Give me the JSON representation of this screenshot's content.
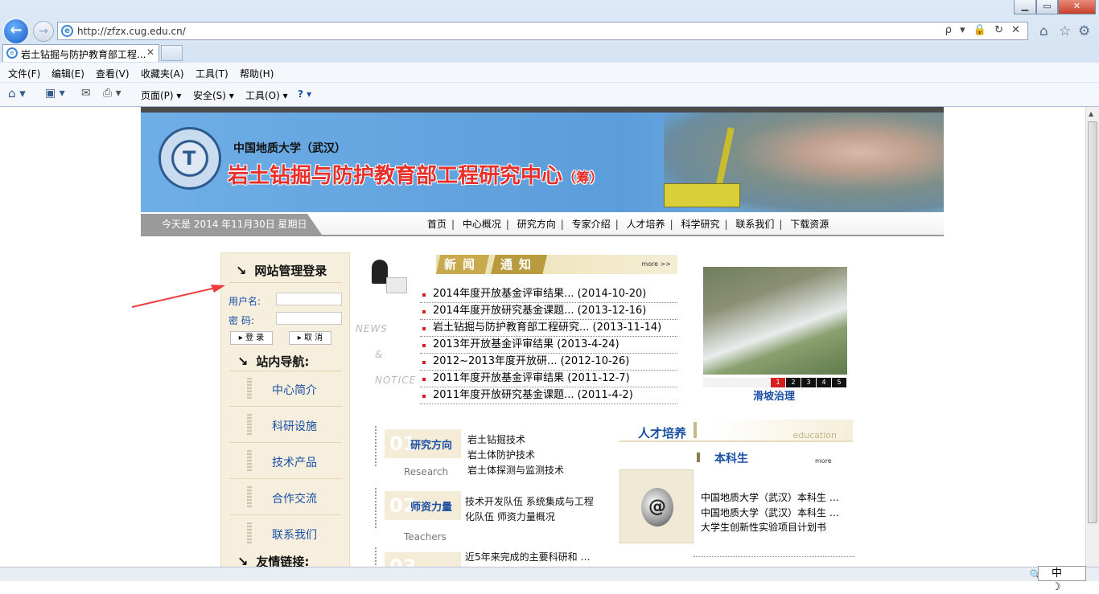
{
  "browser": {
    "url": "http://zfzx.cug.edu.cn/",
    "tab_title": "岩土钻掘与防护教育部工程...",
    "window_controls": [
      "▁",
      "▭",
      "✕"
    ],
    "address_tools": "ρ ▾ 🔒 ↻ ✕",
    "menu": [
      "文件(F)",
      "编辑(E)",
      "查看(V)",
      "收藏夹(A)",
      "工具(T)",
      "帮助(H)"
    ],
    "commands": {
      "page": "页面(P) ▾",
      "safety": "安全(S) ▾",
      "tools": "工具(O) ▾",
      "help": "? ▾"
    },
    "ime": "中 ☽",
    "zoom": "🔍 1"
  },
  "banner": {
    "university": "中国地质大学（武汉）",
    "center_name": "岩土钻掘与防护教育部工程研究中心",
    "center_suffix": "（筹）"
  },
  "nav": {
    "date_text": "今天是  2014 年11月30日  星期日",
    "links": [
      "首页",
      "中心概况",
      "研究方向",
      "专家介绍",
      "人才培养",
      "科学研究",
      "联系我们",
      "下载资源"
    ]
  },
  "sidebar": {
    "login_title": "网站管理登录",
    "username_label": "用户名:",
    "password_label": "密  码:",
    "login_button": "▸ 登 录",
    "cancel_button": "▸ 取 消",
    "site_nav_title": "站内导航:",
    "items": [
      "中心简介",
      "科研设施",
      "技术产品",
      "合作交流",
      "联系我们"
    ],
    "friend_links_title": "友情链接:"
  },
  "news": {
    "tab1": "新闻",
    "tab2": "通知",
    "more": "more >>",
    "side_label_1": "NEWS",
    "side_label_2": "&",
    "side_label_3": "NOTICE",
    "items": [
      "2014年度开放基金评审结果... (2014-10-20)",
      "2014年度开放研究基金课题... (2013-12-16)",
      "岩土钻掘与防护教育部工程研究... (2013-11-14)",
      "2013年开放基金评审结果 (2013-4-24)",
      "2012~2013年度开放研... (2012-10-26)",
      "2011年度开放基金评审结果 (2011-12-7)",
      "2011年度开放研究基金课题... (2011-4-2)"
    ]
  },
  "slideshow": {
    "caption": "滑坡治理",
    "pages": [
      "1",
      "2",
      "3",
      "4",
      "5"
    ]
  },
  "sections": [
    {
      "num": "01",
      "title": "研究方向",
      "en": "Research",
      "lines": [
        "岩土钻掘技术",
        "岩土体防护技术",
        "岩土体探测与监测技术"
      ]
    },
    {
      "num": "02",
      "title": "师资力量",
      "en": "Teachers",
      "lines": [
        "技术开发队伍  系统集成与工程",
        "化队伍  师资力量概况"
      ]
    },
    {
      "num": "03",
      "title": "",
      "en": "",
      "lines": [
        "近5年来完成的主要科研和  …"
      ]
    }
  ],
  "talent": {
    "title": "人才培养",
    "en": "education",
    "sub": "本科生",
    "more": "more",
    "items": [
      "中国地质大学（武汉）本科生  …",
      "中国地质大学（武汉）本科生  …",
      "大学生创新性实验项目计划书"
    ]
  },
  "colors": {
    "link_blue": "#1a4fa5",
    "accent_red": "#e8302b",
    "banner_blue": "#5b9ddb",
    "annotation_red": "#f03c3c"
  }
}
